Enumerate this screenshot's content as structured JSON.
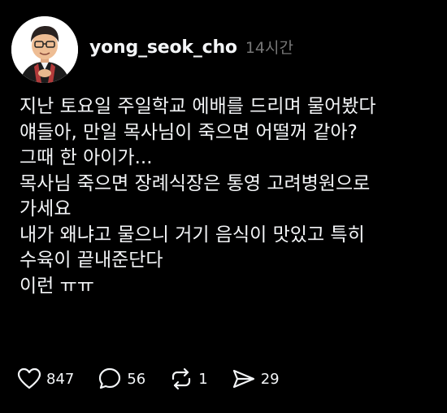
{
  "post": {
    "username": "yong_seok_cho",
    "timestamp": "14시간",
    "lines": [
      "지난 토요일 주일학교 에배를 드리며 물어봤다",
      "얘들아, 만일 목사님이 죽으면 어떨꺼 같아?",
      "그때 한 아이가...",
      "목사님 죽으면 장례식장은 통영 고려병원으로",
      "가세요",
      "내가 왜냐고 물으니 거기 음식이 맛있고 특히",
      "수육이 끝내준단다",
      "이런 ㅠㅠ"
    ]
  },
  "actions": {
    "like": {
      "icon": "heart-icon",
      "count": "847"
    },
    "comment": {
      "icon": "comment-bubble-icon",
      "count": "56"
    },
    "repost": {
      "icon": "repost-icon",
      "count": "1"
    },
    "share": {
      "icon": "send-icon",
      "count": "29"
    }
  },
  "colors": {
    "background": "#000000",
    "text": "#f3f5f7",
    "muted": "#777777"
  }
}
